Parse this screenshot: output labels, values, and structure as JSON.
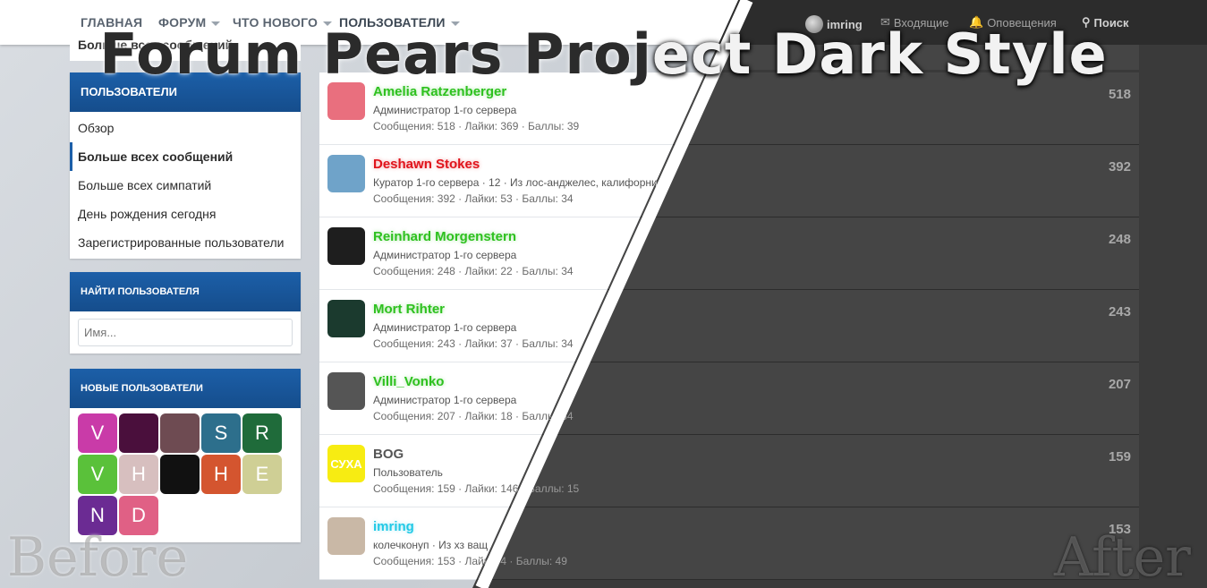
{
  "banner": {
    "title_left": "Forum Pears Proj",
    "title_right": "ect Dark Style",
    "before": "Before",
    "after": "After"
  },
  "nav": {
    "home": "ГЛАВНАЯ",
    "forum": "ФОРУМ",
    "whats_new": "ЧТО НОВОГО",
    "members": "ПОЛЬЗОВАТЕЛИ",
    "username": "imring",
    "inbox": "Входящие",
    "alerts": "Оповещения",
    "search": "Поиск"
  },
  "sidebar": {
    "partial_label": "Больше всех сообщений",
    "members_block": {
      "title": "ПОЛЬЗОВАТЕЛИ",
      "items": [
        {
          "label": "Обзор"
        },
        {
          "label": "Больше всех сообщений"
        },
        {
          "label": "Больше всех симпатий"
        },
        {
          "label": "День рождения сегодня"
        },
        {
          "label": "Зарегистрированные пользователи"
        }
      ]
    },
    "find_block": {
      "title": "НАЙТИ ПОЛЬЗОВАТЕЛЯ",
      "placeholder": "Имя..."
    },
    "new_block": {
      "title": "НОВЫЕ ПОЛЬЗОВАТЕЛИ",
      "avatars": [
        {
          "letter": "V",
          "color": "#c93ba8"
        },
        {
          "letter": "",
          "color": "#4a0f3c"
        },
        {
          "letter": "",
          "color": "#6e4b52"
        },
        {
          "letter": "S",
          "color": "#2d6f8c"
        },
        {
          "letter": "R",
          "color": "#1f6b3a"
        },
        {
          "letter": "V",
          "color": "#5ac13a"
        },
        {
          "letter": "H",
          "color": "#d7bfbf"
        },
        {
          "letter": "",
          "color": "#111111"
        },
        {
          "letter": "H",
          "color": "#d4552f"
        },
        {
          "letter": "E",
          "color": "#cfcf95"
        },
        {
          "letter": "N",
          "color": "#6b2b93"
        },
        {
          "letter": "D",
          "color": "#e06085"
        }
      ]
    }
  },
  "members": [
    {
      "name": "Amelia Ratzenberger",
      "name_color": "#2ec11f",
      "title": "Администратор 1-го сервера",
      "stats": "Сообщения: 518 · Лайки: 369 · Баллы: 39",
      "count": "518",
      "avatar_color": "#e96f7e"
    },
    {
      "name": "Deshawn Stokes",
      "name_color": "#e0141c",
      "title": "Куратор 1-го сервера · 12 · Из лос-анджелес, калифорния",
      "stats": "Сообщения: 392 · Лайки: 53 · Баллы: 34",
      "count": "392",
      "avatar_color": "#6fa3c9"
    },
    {
      "name": "Reinhard Morgenstern",
      "name_color": "#2ec11f",
      "title": "Администратор 1-го сервера",
      "stats": "Сообщения: 248 · Лайки: 22 · Баллы: 34",
      "count": "248",
      "avatar_color": "#1e1e1e"
    },
    {
      "name": "Mort Rihter",
      "name_color": "#2ec11f",
      "title": "Администратор 1-го сервера",
      "stats": "Сообщения: 243 · Лайки: 37 · Баллы: 34",
      "count": "243",
      "avatar_color": "#1b3a2e"
    },
    {
      "name": "Villi_Vonko",
      "name_color": "#2ec11f",
      "title": "Администратор 1-го сервера",
      "stats": "Сообщения: 207 · Лайки: 18 · Баллы: 34",
      "count": "207",
      "avatar_color": "#555555"
    },
    {
      "name": "BOG",
      "name_color": "#555555",
      "title": "Пользователь",
      "stats": "Сообщения: 159 · Лайки: 146 · Баллы: 15",
      "count": "159",
      "avatar_color": "#f7ec12",
      "avatar_text": "СУХА"
    },
    {
      "name": "imring",
      "name_color": "#22c9e6",
      "title": "колечконуп · Из хз ващ",
      "stats": "Сообщения: 153 · Лайки: 4 · Баллы: 49",
      "count": "153",
      "avatar_color": "#c9b8a6"
    }
  ]
}
